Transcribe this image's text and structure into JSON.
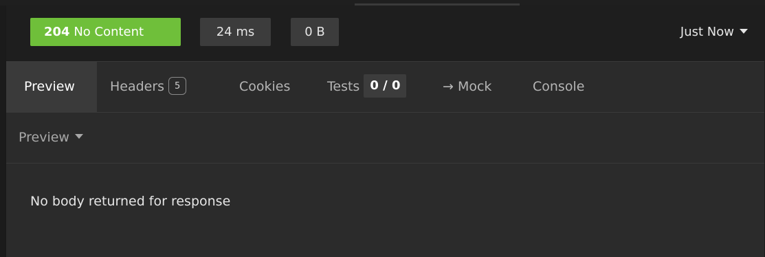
{
  "response": {
    "status_code": "204",
    "status_text": "No Content",
    "status_color": "#6fbf3a",
    "time": "24 ms",
    "size": "0 B",
    "timestamp": "Just Now"
  },
  "tabs": [
    {
      "label": "Preview",
      "active": true
    },
    {
      "label": "Headers",
      "badge": "5"
    },
    {
      "label": "Cookies"
    },
    {
      "label": "Tests",
      "badge": "0 / 0"
    },
    {
      "label": "→ Mock"
    },
    {
      "label": "Console"
    }
  ],
  "preview_mode": {
    "label": "Preview"
  },
  "body": {
    "message": "No body returned for response"
  }
}
